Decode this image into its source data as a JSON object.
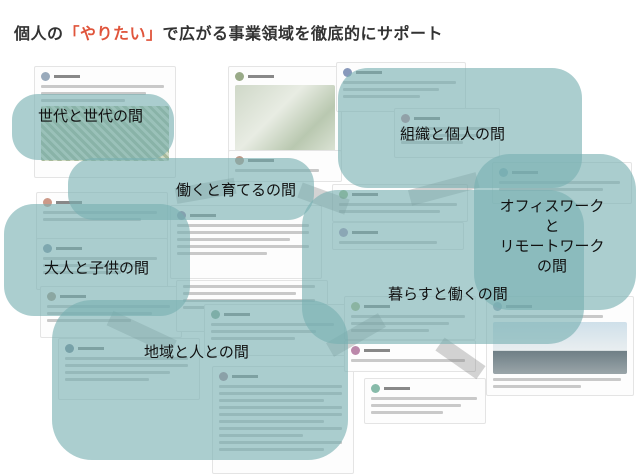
{
  "headline": {
    "prefix": "個人の",
    "accent": "「やりたい」",
    "suffix": "で広がる事業領域を徹底的にサポート"
  },
  "topics": {
    "generations": "世代と世代の間",
    "work_parenting": "働くと育てるの間",
    "org_individual": "組織と個人の間",
    "office_remote_line1": "オフィスワーク",
    "office_remote_line2": "と",
    "office_remote_line3": "リモートワーク",
    "office_remote_line4": "の間",
    "adults_children": "大人と子供の間",
    "living_working": "暮らすと働くの間",
    "region_people": "地域と人との間"
  },
  "colors": {
    "accent": "#e0553c",
    "bubble": "#78b0b2",
    "headline": "#333333"
  }
}
